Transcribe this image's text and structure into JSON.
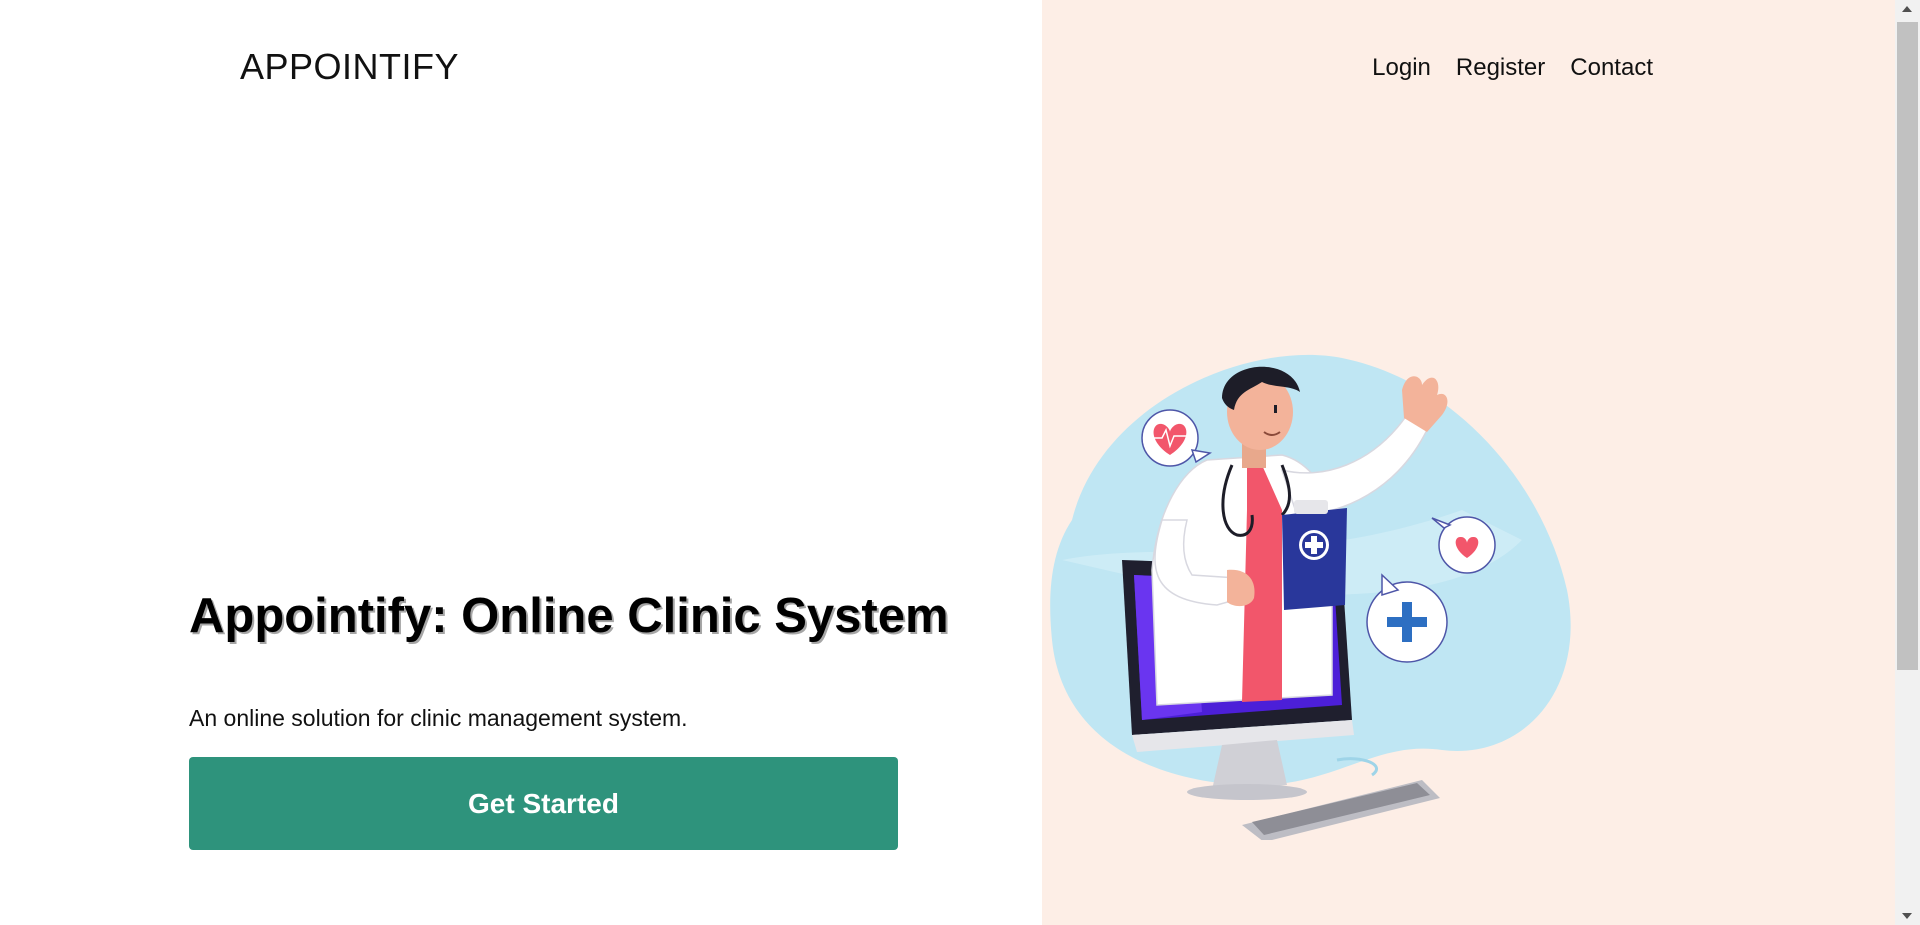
{
  "header": {
    "logo": "APPOINTIFY",
    "nav": {
      "login": "Login",
      "register": "Register",
      "contact": "Contact"
    }
  },
  "hero": {
    "title": "Appointify: Online Clinic System",
    "subtitle": "An online solution for clinic management system.",
    "cta_label": "Get Started"
  },
  "colors": {
    "accent": "#2e937c",
    "right_panel_bg": "#fdeee6",
    "blob": "#bfe6f3"
  }
}
